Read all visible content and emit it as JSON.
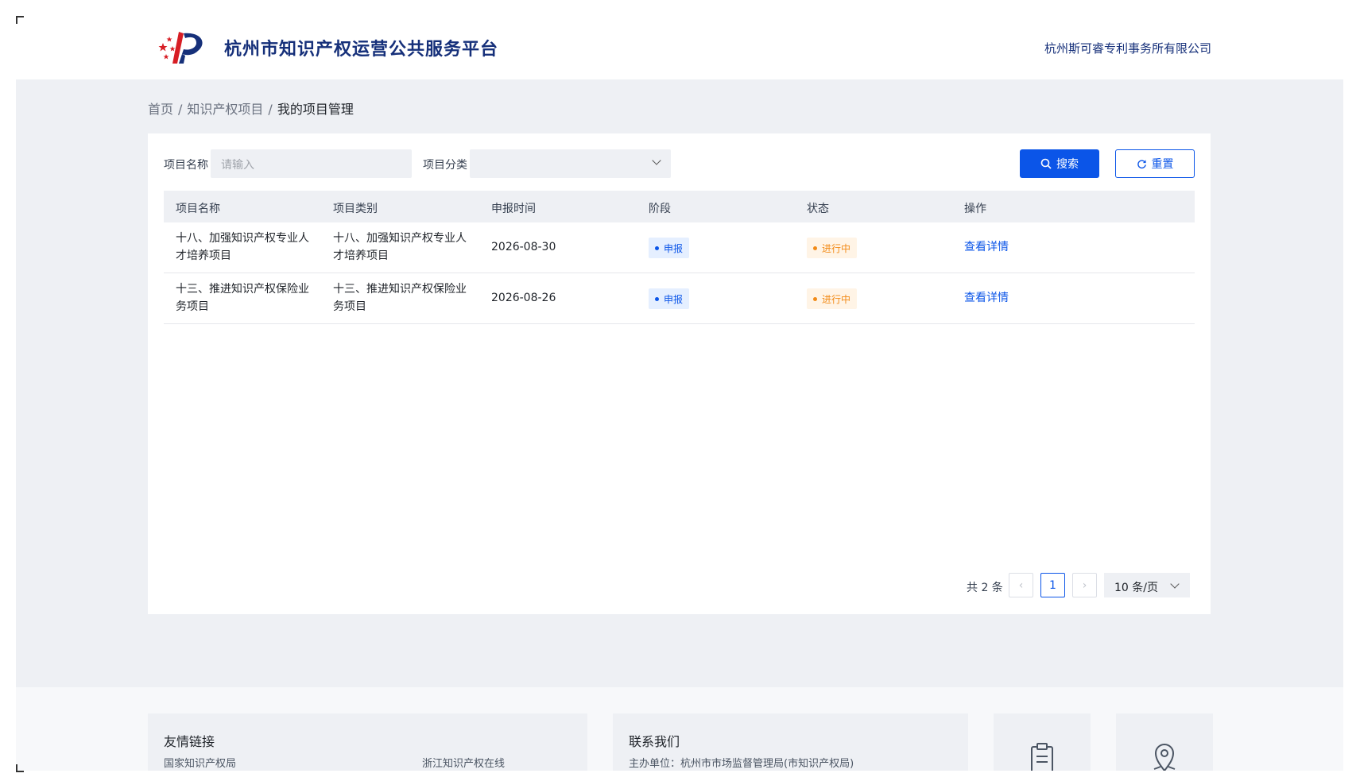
{
  "header": {
    "site_title": "杭州市知识产权运营公共服务平台",
    "company": "杭州斯可睿专利事务所有限公司"
  },
  "breadcrumb": {
    "home": "首页",
    "section": "知识产权项目",
    "current": "我的项目管理",
    "separator": "/"
  },
  "filter": {
    "name_label": "项目名称",
    "name_placeholder": "请输入",
    "category_label": "项目分类",
    "category_value": "",
    "search_label": "搜索",
    "reset_label": "重置"
  },
  "table": {
    "columns": [
      "项目名称",
      "项目类别",
      "申报时间",
      "阶段",
      "状态",
      "操作"
    ],
    "rows": [
      {
        "name": "十八、加强知识产权专业人才培养项目",
        "category": "十八、加强知识产权专业人才培养项目",
        "date": "2026-08-30",
        "stage": "申报",
        "status": "进行中",
        "action": "查看详情"
      },
      {
        "name": "十三、推进知识产权保险业务项目",
        "category": "十三、推进知识产权保险业务项目",
        "date": "2026-08-26",
        "stage": "申报",
        "status": "进行中",
        "action": "查看详情"
      }
    ]
  },
  "pagination": {
    "total_text": "共 2 条",
    "prev": "‹",
    "current_page": "1",
    "next": "›",
    "page_size": "10 条/页"
  },
  "footer": {
    "links_title": "友情链接",
    "links": [
      "国家知识产权局",
      "浙江知识产权在线"
    ],
    "contact_title": "联系我们",
    "contact_host": "主办单位：杭州市市场监督管理局(市知识产权局)"
  },
  "colors": {
    "primary": "#0b55e8",
    "title_navy": "#16307a",
    "status_orange": "#f28a16",
    "bg_gray": "#eef0f4"
  },
  "icons": [
    "logo-emblem",
    "search-icon",
    "refresh-icon",
    "chevron-down-icon",
    "clipboard-icon",
    "location-pin-icon"
  ]
}
